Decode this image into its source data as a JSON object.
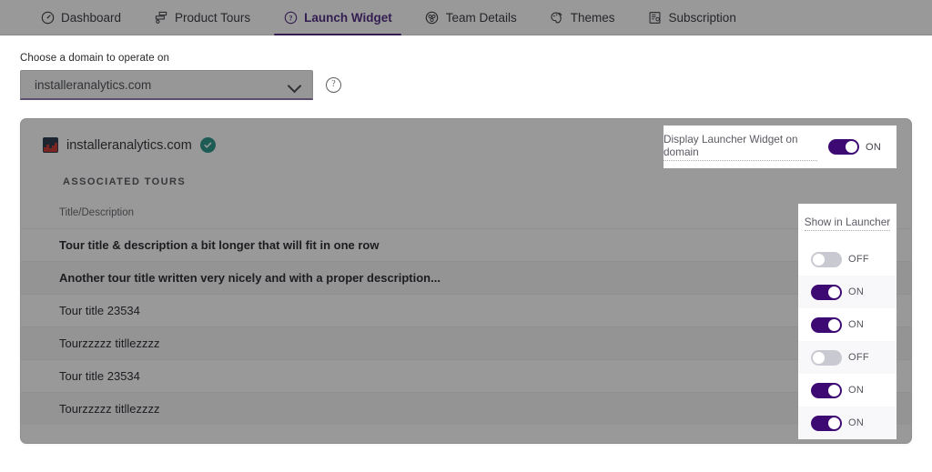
{
  "nav": {
    "tabs": [
      {
        "label": "Dashboard",
        "icon": "gauge-icon",
        "active": false
      },
      {
        "label": "Product Tours",
        "icon": "sitemap-icon",
        "active": false
      },
      {
        "label": "Launch Widget",
        "icon": "question-circle-icon",
        "active": true
      },
      {
        "label": "Team Details",
        "icon": "team-icon",
        "active": false
      },
      {
        "label": "Themes",
        "icon": "palette-icon",
        "active": false
      },
      {
        "label": "Subscription",
        "icon": "invoice-icon",
        "active": false
      }
    ]
  },
  "chooser": {
    "label": "Choose a domain to operate on",
    "selected": "installeranalytics.com",
    "chevron_icon": "chevron-down-icon",
    "help_icon": "help-circle-icon",
    "help_glyph": "?"
  },
  "card": {
    "domain": "installeranalytics.com",
    "favicon_icon": "site-favicon-icon",
    "verified_icon": "verified-check-icon",
    "section_title": "ASSOCIATED TOURS",
    "column_header": "Title/Description",
    "rows": [
      {
        "title": "Tour title & description a bit longer that will fit in one row"
      },
      {
        "title": "Another tour title written very nicely and with a proper description..."
      },
      {
        "title": "Tour title 23534"
      },
      {
        "title": "Tourzzzzz titllezzzz"
      },
      {
        "title": "Tour title 23534"
      },
      {
        "title": "Tourzzzzz titllezzzz"
      }
    ]
  },
  "display_widget": {
    "label": "Display Launcher Widget on domain",
    "state": "on",
    "state_label": "ON"
  },
  "show_in_launcher": {
    "header": "Show in Launcher",
    "toggles": [
      {
        "state": "off",
        "state_label": "OFF"
      },
      {
        "state": "on",
        "state_label": "ON"
      },
      {
        "state": "on",
        "state_label": "ON"
      },
      {
        "state": "off",
        "state_label": "OFF"
      },
      {
        "state": "on",
        "state_label": "ON"
      },
      {
        "state": "on",
        "state_label": "ON"
      }
    ]
  },
  "colors": {
    "accent_purple": "#5b2d9c",
    "toggle_on": "#3d0a74",
    "toggle_off": "#c9cad1",
    "verified_teal": "#19a08e",
    "favicon_bg": "#2c3e56",
    "favicon_chart": "#e8382f"
  }
}
